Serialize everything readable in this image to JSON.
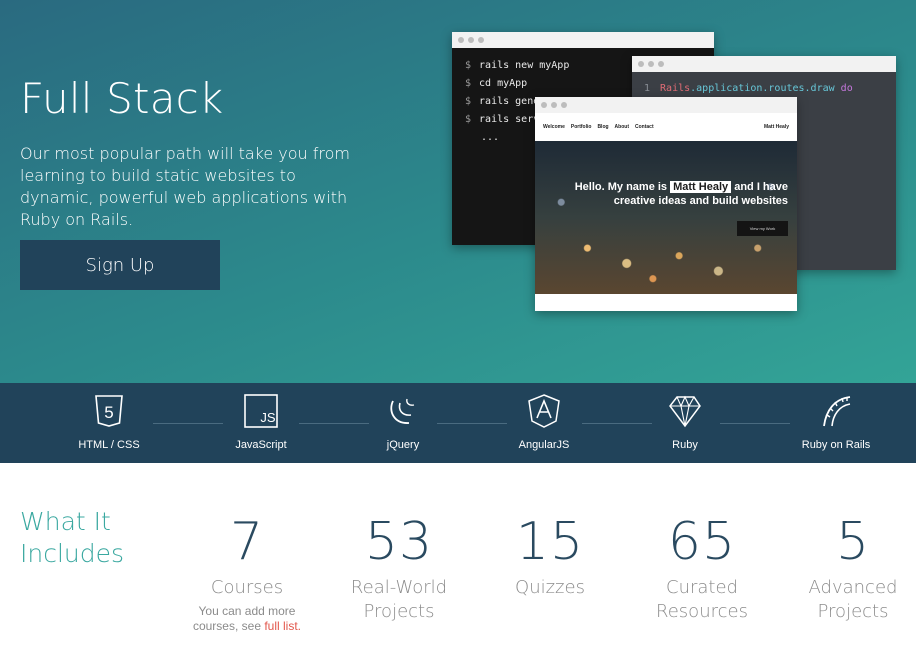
{
  "hero": {
    "title": "Full Stack",
    "description": "Our most popular path will take you from learning to build static websites to dynamic, powerful web applications with Ruby on Rails.",
    "signup_label": "Sign Up"
  },
  "terminal": {
    "prompt": "$",
    "lines": [
      "rails new myApp",
      "cd myApp",
      "rails generate",
      "rails server",
      "..."
    ]
  },
  "editor": {
    "line_number": "1",
    "code_part1": "Rails",
    "code_part2": ".application.routes.draw",
    "code_part3": "do"
  },
  "site_mock": {
    "nav": [
      "Welcome",
      "Portfolio",
      "Blog",
      "About",
      "Contact"
    ],
    "brand": "Matt Healy",
    "headline_pre": "Hello. My name is",
    "headline_name": "Matt Healy",
    "headline_post": "and I have creative ideas and build websites",
    "cta": "View my Work"
  },
  "path": {
    "items": [
      {
        "label": "HTML / CSS",
        "icon": "html5-icon"
      },
      {
        "label": "JavaScript",
        "icon": "javascript-icon"
      },
      {
        "label": "jQuery",
        "icon": "jquery-icon"
      },
      {
        "label": "AngularJS",
        "icon": "angularjs-icon"
      },
      {
        "label": "Ruby",
        "icon": "ruby-gem-icon"
      },
      {
        "label": "Ruby on Rails",
        "icon": "rails-icon"
      }
    ]
  },
  "includes": {
    "title_line1": "What It",
    "title_line2": "Includes",
    "stats": [
      {
        "value": "7",
        "label_line1": "Courses",
        "label_line2": ""
      },
      {
        "value": "53",
        "label_line1": "Real-World",
        "label_line2": "Projects"
      },
      {
        "value": "15",
        "label_line1": "Quizzes",
        "label_line2": ""
      },
      {
        "value": "65",
        "label_line1": "Curated",
        "label_line2": "Resources"
      },
      {
        "value": "5",
        "label_line1": "Advanced",
        "label_line2": "Projects"
      }
    ],
    "note_text": "You can add more courses, see",
    "note_link": "full list."
  },
  "colors": {
    "accent": "#3aa8a0",
    "navy": "#21435a",
    "link": "#e2574c"
  }
}
